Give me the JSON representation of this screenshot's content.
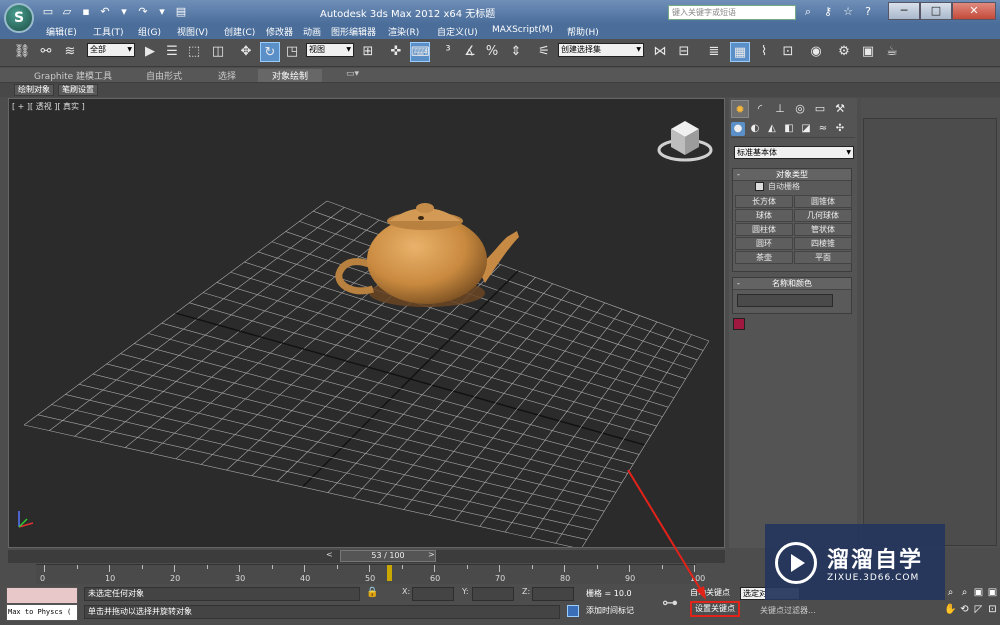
{
  "titlebar": {
    "logo": "S",
    "title": "Autodesk 3ds Max  2012 x64        无标题",
    "search_placeholder": "键入关键字或短语",
    "window_buttons": [
      "─",
      "□",
      "✕"
    ]
  },
  "menu": [
    "编辑(E)",
    "工具(T)",
    "组(G)",
    "视图(V)",
    "创建(C)",
    "修改器",
    "动画",
    "图形编辑器",
    "渲染(R)",
    "自定义(U)",
    "MAXScript(M)",
    "帮助(H)"
  ],
  "toolbar": {
    "selection_filter": "全部",
    "ref_coord": "视图",
    "named_selection": "创建选择集"
  },
  "ribbon": {
    "tabs": [
      "Graphite 建模工具",
      "自由形式",
      "选择",
      "对象绘制"
    ],
    "active_tab": "对象绘制",
    "sub_buttons": [
      "绘制对象",
      "笔刷设置"
    ]
  },
  "viewport": {
    "label": "[ + ][ 透视 ][ 真实 ]"
  },
  "command_panel": {
    "category": "标准基本体",
    "object_type_title": "对象类型",
    "autogrid": "自动栅格",
    "objects": [
      "长方体",
      "圆锥体",
      "球体",
      "几何球体",
      "圆柱体",
      "管状体",
      "圆环",
      "四棱锥",
      "茶壶",
      "平面"
    ],
    "name_color_title": "名称和颜色",
    "object_color": "#a01840"
  },
  "timeline": {
    "slider": "53 / 100",
    "current_frame": 53,
    "ticks": [
      "0",
      "10",
      "20",
      "30",
      "40",
      "50",
      "60",
      "70",
      "80",
      "90",
      "100"
    ]
  },
  "status": {
    "maxscript_text": "Max to Physcs (",
    "selection": "未选定任何对象",
    "prompt": "单击并拖动以选择并旋转对象",
    "x_label": "X:",
    "y_label": "Y:",
    "z_label": "Z:",
    "grid": "栅格 = 10.0",
    "add_time_tag": "添加时间标记",
    "auto_key": "自动关键点",
    "selection_set": "选定对",
    "set_key": "设置关键点",
    "key_filter": "关键点过滤器..."
  },
  "watermark": {
    "cn": "溜溜自学",
    "url": "ZIXUE.3D66.COM"
  }
}
